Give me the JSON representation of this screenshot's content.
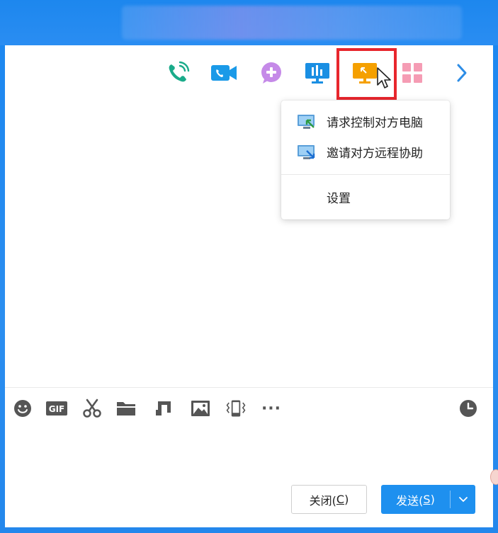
{
  "toolbar_top": {
    "icons": [
      "phone-icon",
      "video-call-icon",
      "add-chat-icon",
      "screen-share-icon",
      "remote-assist-icon",
      "apps-grid-icon",
      "chevron-right-icon"
    ]
  },
  "remote_menu": {
    "items": [
      {
        "label": "请求控制对方电脑",
        "icon": "request-control-icon"
      },
      {
        "label": "邀请对方远程协助",
        "icon": "invite-assist-icon"
      },
      {
        "label": "设置"
      }
    ]
  },
  "bottom_toolbar": {
    "icons": [
      "emoji-icon",
      "gif-icon",
      "scissors-icon",
      "folder-icon",
      "music-icon",
      "image-icon",
      "shake-icon",
      "more-icon",
      "history-clock-icon"
    ],
    "gif_label": "GIF",
    "more_label": "···"
  },
  "buttons": {
    "close_prefix": "关闭(",
    "close_hotkey": "C",
    "close_suffix": ")",
    "send_prefix": "发送(",
    "send_hotkey": "S",
    "send_suffix": ")"
  },
  "colors": {
    "title_bar": "#1d87ee",
    "accent": "#1e90ef",
    "highlight": "#e8262d",
    "remote_icon": "#f5a000"
  }
}
